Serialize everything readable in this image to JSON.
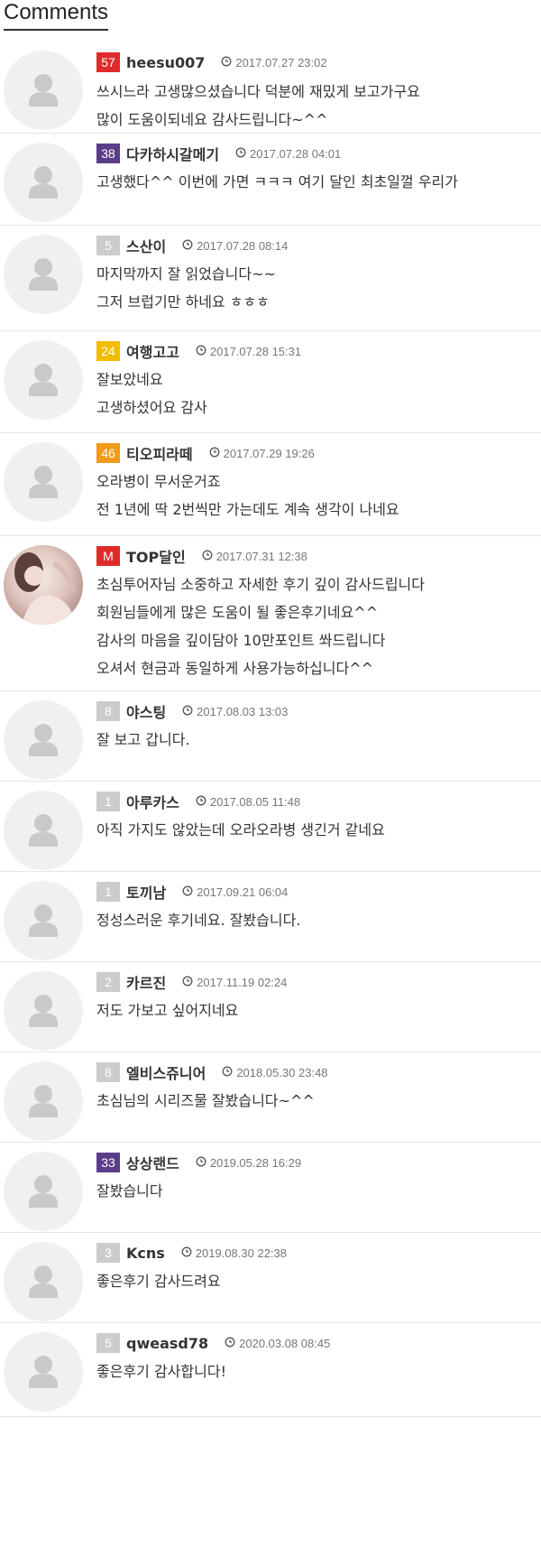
{
  "section": {
    "title": "Comments"
  },
  "colors": {
    "red": "#e02b2b",
    "purple": "#5a3d8a",
    "gray": "#cccccc",
    "yellow": "#f2bc00",
    "orange": "#f29a1a",
    "admin": "#e02b2b"
  },
  "comments": [
    {
      "level": "57",
      "level_color": "#e02b2b",
      "nick": "heesu007",
      "time": "2017.07.27 23:02",
      "lines": [
        "쓰시느라 고생많으셨습니다 덕분에 재밌게 보고가구요",
        "많이 도움이되네요 감사드립니다~^^"
      ],
      "avatar": "person-icon"
    },
    {
      "level": "38",
      "level_color": "#5a3d8a",
      "nick": "다카하시갈메기",
      "time": "2017.07.28 04:01",
      "lines": [
        "고생했다^^ 이번에 가면  ㅋㅋㅋ 여기 달인 최초일껄 우리가"
      ],
      "avatar": "person-icon"
    },
    {
      "level": "5",
      "level_color": "#cccccc",
      "nick": "스산이",
      "time": "2017.07.28 08:14",
      "lines": [
        "마지막까지 잘 읽었습니다~~",
        "그저 브럽기만 하네요 ㅎㅎㅎ"
      ],
      "avatar": "person-icon"
    },
    {
      "level": "24",
      "level_color": "#f2bc00",
      "nick": "여행고고",
      "time": "2017.07.28 15:31",
      "lines": [
        "잘보았네요",
        "고생하셨어요 감사"
      ],
      "avatar": "person-icon"
    },
    {
      "level": "46",
      "level_color": "#f29a1a",
      "nick": "티오피라떼",
      "time": "2017.07.29 19:26",
      "lines": [
        "오라병이 무서운거죠",
        "전 1년에 딱 2번씩만 가는데도 계속 생각이 나네요"
      ],
      "avatar": "person-icon"
    },
    {
      "level": "M",
      "level_color": "#e02b2b",
      "nick": "TOP달인",
      "time": "2017.07.31 12:38",
      "lines": [
        "초심투어자님 소중하고 자세한 후기 깊이 감사드립니다",
        "회원님들에게 많은 도움이 될 좋은후기네요^^",
        "감사의 마음을 깊이담아 10만포인트 쏴드립니다",
        "오셔서 현금과 동일하게 사용가능하십니다^^"
      ],
      "avatar": "profile-photo"
    },
    {
      "level": "8",
      "level_color": "#cccccc",
      "nick": "야스팅",
      "time": "2017.08.03 13:03",
      "lines": [
        "잘 보고 갑니다."
      ],
      "avatar": "person-icon"
    },
    {
      "level": "1",
      "level_color": "#cccccc",
      "nick": "아루카스",
      "time": "2017.08.05 11:48",
      "lines": [
        "아직 가지도 않았는데 오라오라병 생긴거 같네요"
      ],
      "avatar": "person-icon"
    },
    {
      "level": "1",
      "level_color": "#cccccc",
      "nick": "토끼남",
      "time": "2017.09.21 06:04",
      "lines": [
        "정성스러운 후기네요. 잘봤습니다."
      ],
      "avatar": "person-icon"
    },
    {
      "level": "2",
      "level_color": "#cccccc",
      "nick": "카르진",
      "time": "2017.11.19 02:24",
      "lines": [
        "저도 가보고 싶어지네요"
      ],
      "avatar": "person-icon"
    },
    {
      "level": "8",
      "level_color": "#cccccc",
      "nick": "엘비스쥬니어",
      "time": "2018.05.30 23:48",
      "lines": [
        "초심님의 시리즈물 잘봤습니다~^^"
      ],
      "avatar": "person-icon"
    },
    {
      "level": "33",
      "level_color": "#5a3d8a",
      "nick": "상상랜드",
      "time": "2019.05.28 16:29",
      "lines": [
        "잘봤습니다"
      ],
      "avatar": "person-icon"
    },
    {
      "level": "3",
      "level_color": "#cccccc",
      "nick": "Kcns",
      "time": "2019.08.30 22:38",
      "lines": [
        "좋은후기 감사드려요"
      ],
      "avatar": "person-icon"
    },
    {
      "level": "5",
      "level_color": "#cccccc",
      "nick": "qweasd78",
      "time": "2020.03.08 08:45",
      "lines": [
        "좋은후기 감사합니다!"
      ],
      "avatar": "person-icon"
    }
  ]
}
